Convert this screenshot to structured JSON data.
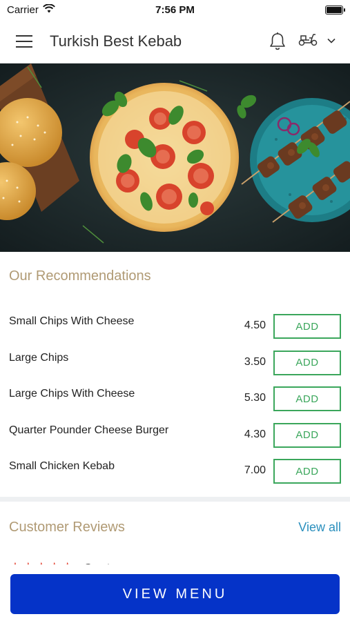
{
  "status_bar": {
    "carrier": "Carrier",
    "time": "7:56 PM"
  },
  "header": {
    "title": "Turkish Best Kebab"
  },
  "recommendations": {
    "title": "Our Recommendations",
    "items": [
      {
        "name": "Small Chips With Cheese",
        "price": "4.50",
        "add_label": "ADD"
      },
      {
        "name": "Large Chips",
        "price": "3.50",
        "add_label": "ADD"
      },
      {
        "name": "Large Chips With Cheese",
        "price": "5.30",
        "add_label": "ADD"
      },
      {
        "name": "Quarter Pounder Cheese Burger",
        "price": "4.30",
        "add_label": "ADD"
      },
      {
        "name": "Small Chicken Kebab",
        "price": "7.00",
        "add_label": "ADD"
      }
    ]
  },
  "reviews": {
    "title": "Customer Reviews",
    "view_all": "View all",
    "first_review": {
      "rating": 5,
      "stars": "★★★★★",
      "author": "Grant"
    }
  },
  "cta": {
    "label": "VIEW MENU"
  },
  "colors": {
    "accent_tan": "#b09a74",
    "add_green": "#3aa65b",
    "link_blue": "#2a8fbd",
    "cta_blue": "#0533c8",
    "star_red": "#e23c2a"
  },
  "icons": [
    "wifi-icon",
    "battery-icon",
    "hamburger-menu-icon",
    "bell-icon",
    "scooter-icon",
    "chevron-down-icon"
  ]
}
